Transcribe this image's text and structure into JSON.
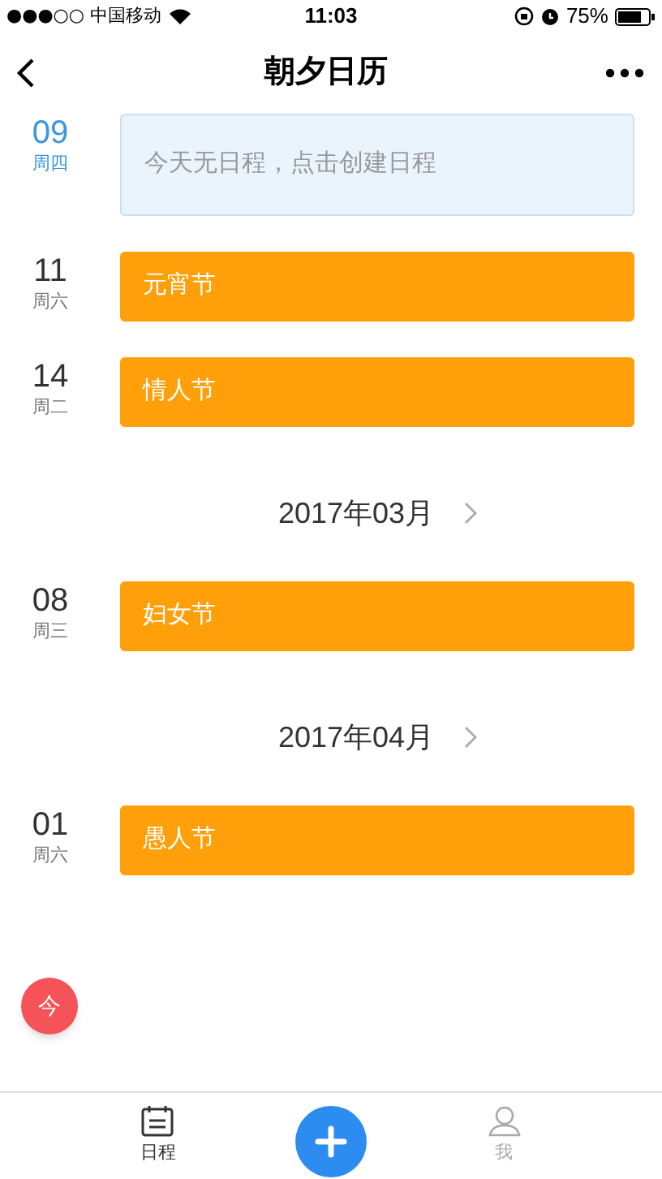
{
  "status_bar": {
    "carrier": "●●●○○ 中国移动",
    "time": "11:03",
    "battery": "75%"
  },
  "nav": {
    "title": "朝夕日历"
  },
  "entries": [
    {
      "kind": "day",
      "day": "09",
      "weekday": "周四",
      "today": true,
      "event": "今天无日程，点击创建日程"
    },
    {
      "kind": "day",
      "day": "11",
      "weekday": "周六",
      "today": false,
      "event": "元宵节"
    },
    {
      "kind": "day",
      "day": "14",
      "weekday": "周二",
      "today": false,
      "event": "情人节"
    },
    {
      "kind": "month",
      "label": "2017年03月"
    },
    {
      "kind": "day",
      "day": "08",
      "weekday": "周三",
      "today": false,
      "event": "妇女节"
    },
    {
      "kind": "month",
      "label": "2017年04月"
    },
    {
      "kind": "day",
      "day": "01",
      "weekday": "周六",
      "today": false,
      "event": "愚人节"
    }
  ],
  "today_button": "今",
  "tabs": [
    {
      "label": "日程",
      "kind": "calendar",
      "selected": true
    },
    {
      "label": "我",
      "kind": "person",
      "selected": false
    }
  ]
}
